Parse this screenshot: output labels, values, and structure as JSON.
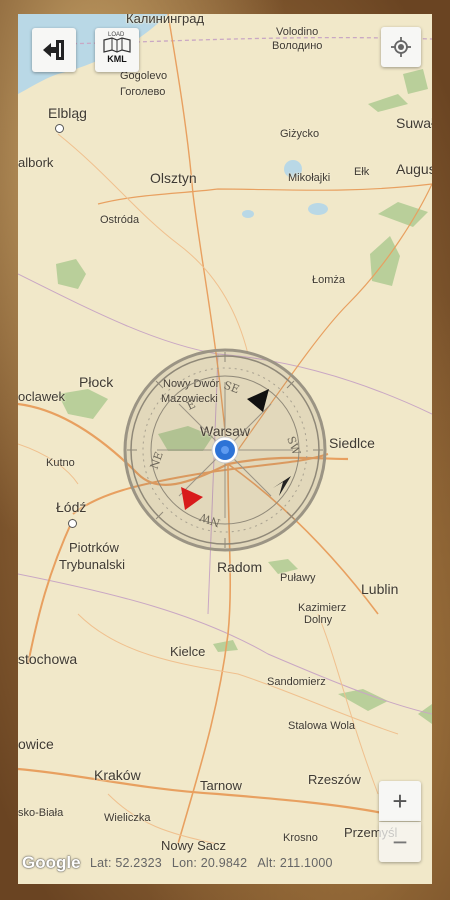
{
  "toolbar": {
    "exit_icon": "exit-arrow-icon",
    "load_kml_small": "LOAD",
    "load_kml_label": "KML",
    "my_location_icon": "crosshair-icon"
  },
  "map": {
    "places": [
      {
        "id": "kaliningrad",
        "label": "Калининград"
      },
      {
        "id": "volodino",
        "label": "Volodino"
      },
      {
        "id": "volodino_cyr",
        "label": "Володино"
      },
      {
        "id": "gogolevo",
        "label": "Gogolevo"
      },
      {
        "id": "gogolevo_cyr",
        "label": "Гоголево"
      },
      {
        "id": "elblag",
        "label": "Elbląg"
      },
      {
        "id": "suwalki",
        "label": "Suwał"
      },
      {
        "id": "augustow",
        "label": "Augus"
      },
      {
        "id": "malbork",
        "label": "albork"
      },
      {
        "id": "gizycko",
        "label": "Giżycko"
      },
      {
        "id": "olsztyn",
        "label": "Olsztyn"
      },
      {
        "id": "mikolajki",
        "label": "Mikołajki"
      },
      {
        "id": "elk",
        "label": "Ełk"
      },
      {
        "id": "ostroda",
        "label": "Ostróda"
      },
      {
        "id": "lomza",
        "label": "Łomża"
      },
      {
        "id": "plock",
        "label": "Płock"
      },
      {
        "id": "nowy_dwor",
        "label": "Nowy Dwór"
      },
      {
        "id": "mazowiecki",
        "label": "Mazowiecki"
      },
      {
        "id": "wloclawek",
        "label": "oclawek"
      },
      {
        "id": "warsaw",
        "label": "Warsaw"
      },
      {
        "id": "siedlce",
        "label": "Siedlce"
      },
      {
        "id": "kutno",
        "label": "Kutno"
      },
      {
        "id": "lodz",
        "label": "Łódź"
      },
      {
        "id": "piotrkow",
        "label": "Piotrków"
      },
      {
        "id": "trybunalski",
        "label": "Trybunalski"
      },
      {
        "id": "radom",
        "label": "Radom"
      },
      {
        "id": "pulawy",
        "label": "Puławy"
      },
      {
        "id": "lublin",
        "label": "Lublin"
      },
      {
        "id": "kazimierz",
        "label": "Kazimierz"
      },
      {
        "id": "dolny",
        "label": "Dolny"
      },
      {
        "id": "czestochowa",
        "label": "stochowa"
      },
      {
        "id": "kielce",
        "label": "Kielce"
      },
      {
        "id": "sandomierz",
        "label": "Sandomierz"
      },
      {
        "id": "stalowa",
        "label": "Stalowa Wola"
      },
      {
        "id": "katowice",
        "label": "owice"
      },
      {
        "id": "krakow",
        "label": "Kraków"
      },
      {
        "id": "tarnow",
        "label": "Tarnow"
      },
      {
        "id": "rzeszow",
        "label": "Rzeszów"
      },
      {
        "id": "bielsko",
        "label": "sko-Biała"
      },
      {
        "id": "wieliczka",
        "label": "Wieliczka"
      },
      {
        "id": "nowy_sacz",
        "label": "Nowy Sacz"
      },
      {
        "id": "krosno",
        "label": "Krosno"
      },
      {
        "id": "przemysl",
        "label": "Przemyśl"
      }
    ],
    "google_logo": "Google"
  },
  "compass": {
    "letters": {
      "n": "N",
      "e": "E",
      "s": "S",
      "w": "W",
      "ne": "NE",
      "se": "SE",
      "sw": "SW",
      "nw": "NW"
    },
    "needle_colors": {
      "north": "#d81b1b",
      "south": "#111111"
    },
    "location_dot_color": "#2d73d6"
  },
  "zoom": {
    "in": "+",
    "out": "−"
  },
  "status": {
    "lat": "Lat: 52.2323",
    "lon": "Lon: 20.9842",
    "alt": "Alt: 211.1000"
  },
  "colors": {
    "map_bg": "#f1e8c9",
    "roads": "#e8a060",
    "water": "#b9d8e6",
    "forest": "#b9cf9a"
  }
}
